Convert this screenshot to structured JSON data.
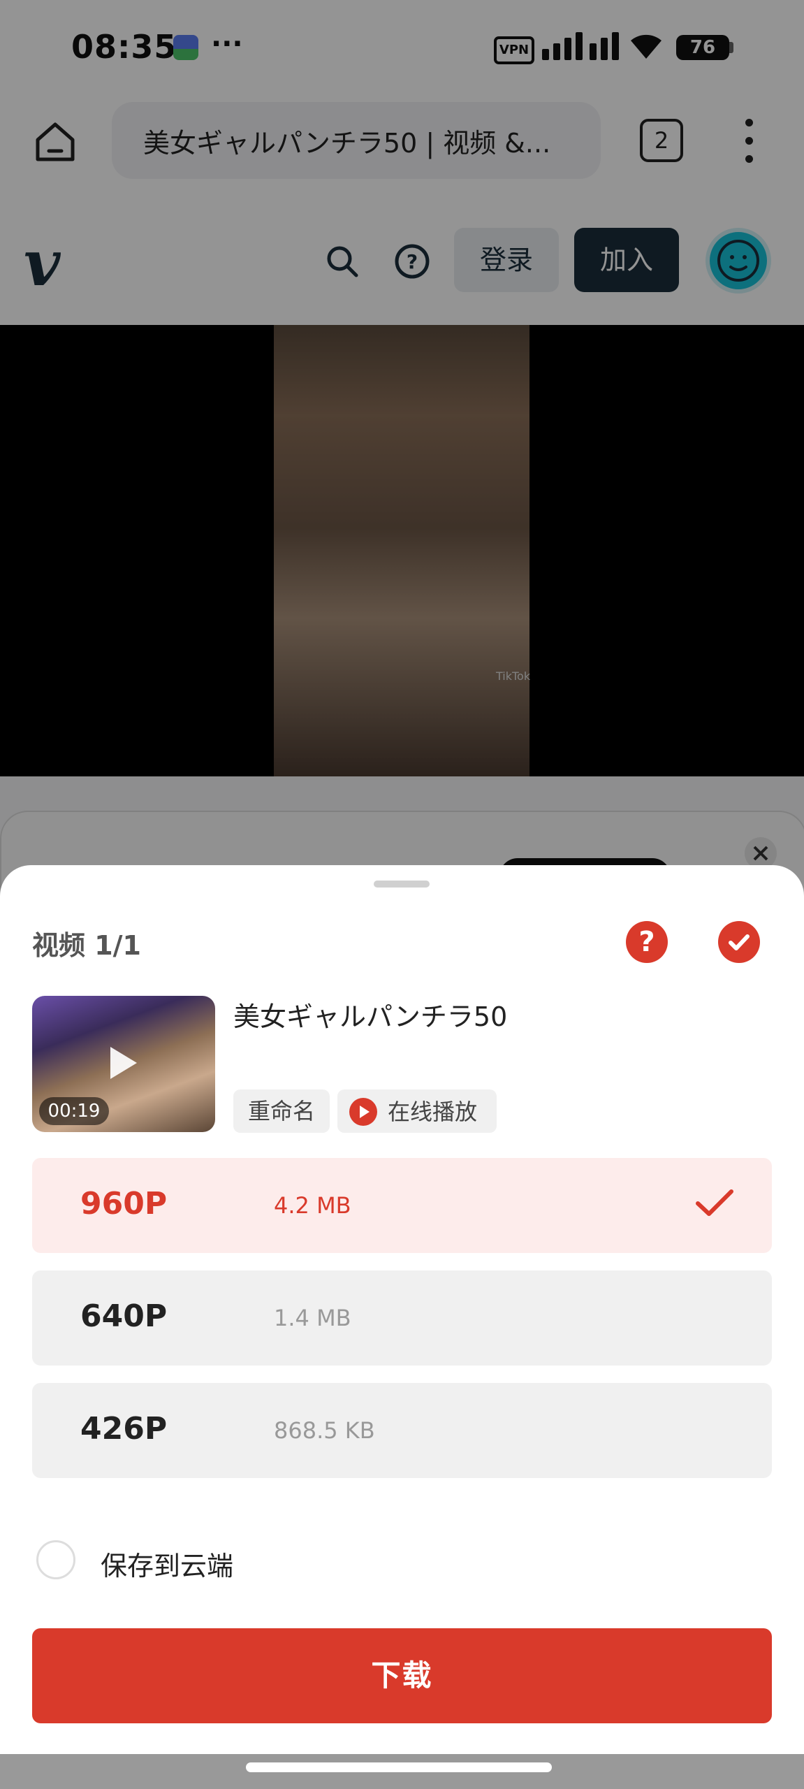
{
  "status_bar": {
    "time": "08:35",
    "more": "···",
    "vpn": "VPN",
    "battery": "76"
  },
  "browser": {
    "url_title": "美女ギャルパンチラ50 | 视频 &...",
    "tab_count": "2"
  },
  "site_header": {
    "logo": "v",
    "login_label": "登录",
    "join_label": "加入"
  },
  "video": {
    "watermark": "TikTok"
  },
  "sheet": {
    "title": "视频 1/1",
    "help_label": "?",
    "item": {
      "name": "美女ギャルパンチラ50",
      "duration": "00:19",
      "rename_label": "重命名",
      "play_online_label": "在线播放"
    },
    "qualities": [
      {
        "label": "960P",
        "size": "4.2 MB",
        "selected": true
      },
      {
        "label": "640P",
        "size": "1.4 MB",
        "selected": false
      },
      {
        "label": "426P",
        "size": "868.5 KB",
        "selected": false
      }
    ],
    "save_to_cloud_label": "保存到云端",
    "download_label": "下载"
  },
  "colors": {
    "accent": "#d93a2b",
    "vimeo_dark": "#1a2e3b"
  }
}
